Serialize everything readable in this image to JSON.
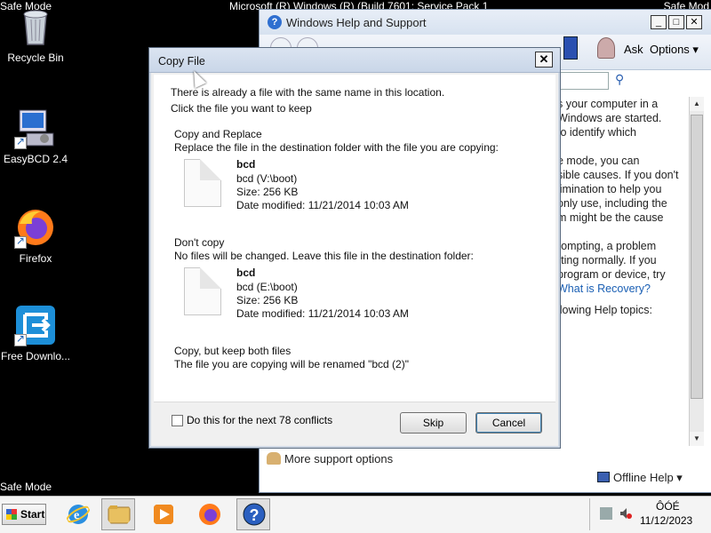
{
  "desktop": {
    "safe_mode_top_left": "Safe Mode",
    "safe_mode_bottom_left": "Safe Mode",
    "safe_mode_top_right": "Safe Mod",
    "top_title": "Microsoft (R) Windows (R) (Build 7601: Service Pack 1)",
    "icons": [
      {
        "label": "Recycle Bin",
        "icon": "recycle-bin-icon"
      },
      {
        "label": "EasyBCD 2.4",
        "icon": "easybcd-icon"
      },
      {
        "label": "Firefox",
        "icon": "firefox-icon"
      },
      {
        "label": "Free Downlo...",
        "icon": "free-download-manager-icon"
      }
    ]
  },
  "help_window": {
    "title": "Windows Help and Support",
    "ask_label": "Ask",
    "options_label": "Options",
    "body_lines": [
      "s your computer in a",
      "Windows are started.",
      "to identify which",
      "e mode, you can",
      "sible causes. If you don't",
      "limination to help you",
      "only use, including the",
      "m might be the cause",
      "rompting, a problem",
      "rting normally. If you",
      "program or device, try",
      "What is Recovery?",
      "llowing Help topics:"
    ],
    "more_support": "More support options",
    "offline_help": "Offline Help"
  },
  "copy_dialog": {
    "title": "Copy File",
    "intro_line1": "There is already a file with the same name in this location.",
    "intro_line2": "Click the file you want to keep",
    "option_replace": {
      "heading": "Copy and Replace",
      "description": "Replace the file in the destination folder with the file you are copying:",
      "file_name": "bcd",
      "file_path": "bcd (V:\\boot)",
      "size": "Size: 256 KB",
      "modified": "Date modified: 11/21/2014 10:03 AM"
    },
    "option_dont_copy": {
      "heading": "Don't copy",
      "description": "No files will be changed. Leave this file in the destination folder:",
      "file_name": "bcd",
      "file_path": "bcd (E:\\boot)",
      "size": "Size: 256 KB",
      "modified": "Date modified: 11/21/2014 10:03 AM"
    },
    "option_keep_both": {
      "heading": "Copy, but keep both files",
      "description": "The file you are copying will be renamed \"bcd (2)\""
    },
    "checkbox_label": "Do this for the next 78 conflicts",
    "skip_label": "Skip",
    "cancel_label": "Cancel"
  },
  "taskbar": {
    "start_label": "Start",
    "apps": [
      "internet-explorer-icon",
      "windows-explorer-icon",
      "media-player-icon",
      "firefox-icon",
      "help-icon"
    ],
    "tray_top": "ÔÓÉ",
    "date": "11/12/2023"
  }
}
